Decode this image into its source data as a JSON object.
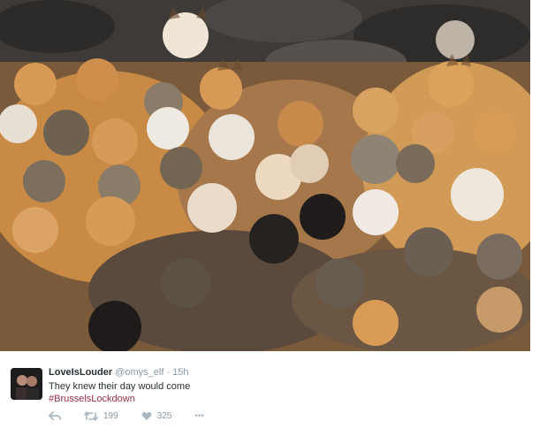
{
  "photo": {
    "subject": "cat-crowd-photo"
  },
  "tweet": {
    "display_name": "LoveIsLouder",
    "handle": "@omys_elf",
    "separator": "·",
    "time": "15h",
    "text": "They knew their day would come",
    "hashtag": "#BrusselsLockdown",
    "actions": {
      "reply_icon": "reply-icon",
      "retweet_icon": "retweet-icon",
      "retweet_count": "199",
      "like_icon": "heart-icon",
      "like_count": "325",
      "more_icon": "more-icon",
      "more_label": "•••"
    }
  },
  "colors": {
    "hashtag": "#9a2f4a",
    "muted": "#8899a6",
    "text": "#292f33"
  }
}
